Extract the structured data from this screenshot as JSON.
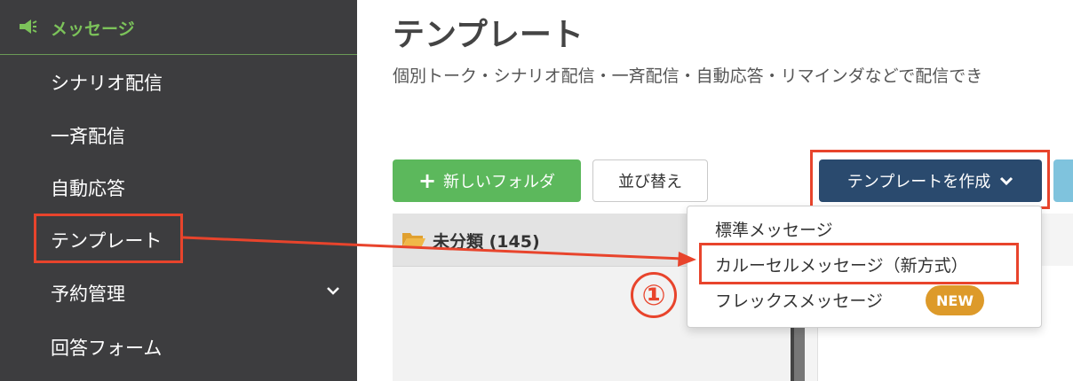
{
  "sidebar": {
    "header": "メッセージ",
    "items": [
      {
        "label": "シナリオ配信"
      },
      {
        "label": "一斉配信"
      },
      {
        "label": "自動応答"
      },
      {
        "label": "テンプレート"
      },
      {
        "label": "予約管理"
      },
      {
        "label": "回答フォーム"
      }
    ],
    "accent_color": "#7cc35a"
  },
  "main": {
    "title": "テンプレート",
    "description": "個別トーク・シナリオ配信・一斉配信・自動応答・リマインダなどで配信でき",
    "buttons": {
      "new_folder": "新しいフォルダ",
      "sort": "並び替え",
      "create_template": "テンプレートを作成"
    },
    "folder": {
      "label": "未分類 (145)"
    }
  },
  "dropdown": {
    "items": [
      {
        "label": "標準メッセージ"
      },
      {
        "label": "カルーセルメッセージ（新方式）"
      },
      {
        "label": "フレックスメッセージ"
      }
    ],
    "new_badge": "NEW"
  },
  "annotation": {
    "step": "①",
    "highlight_color": "#e8442c"
  }
}
